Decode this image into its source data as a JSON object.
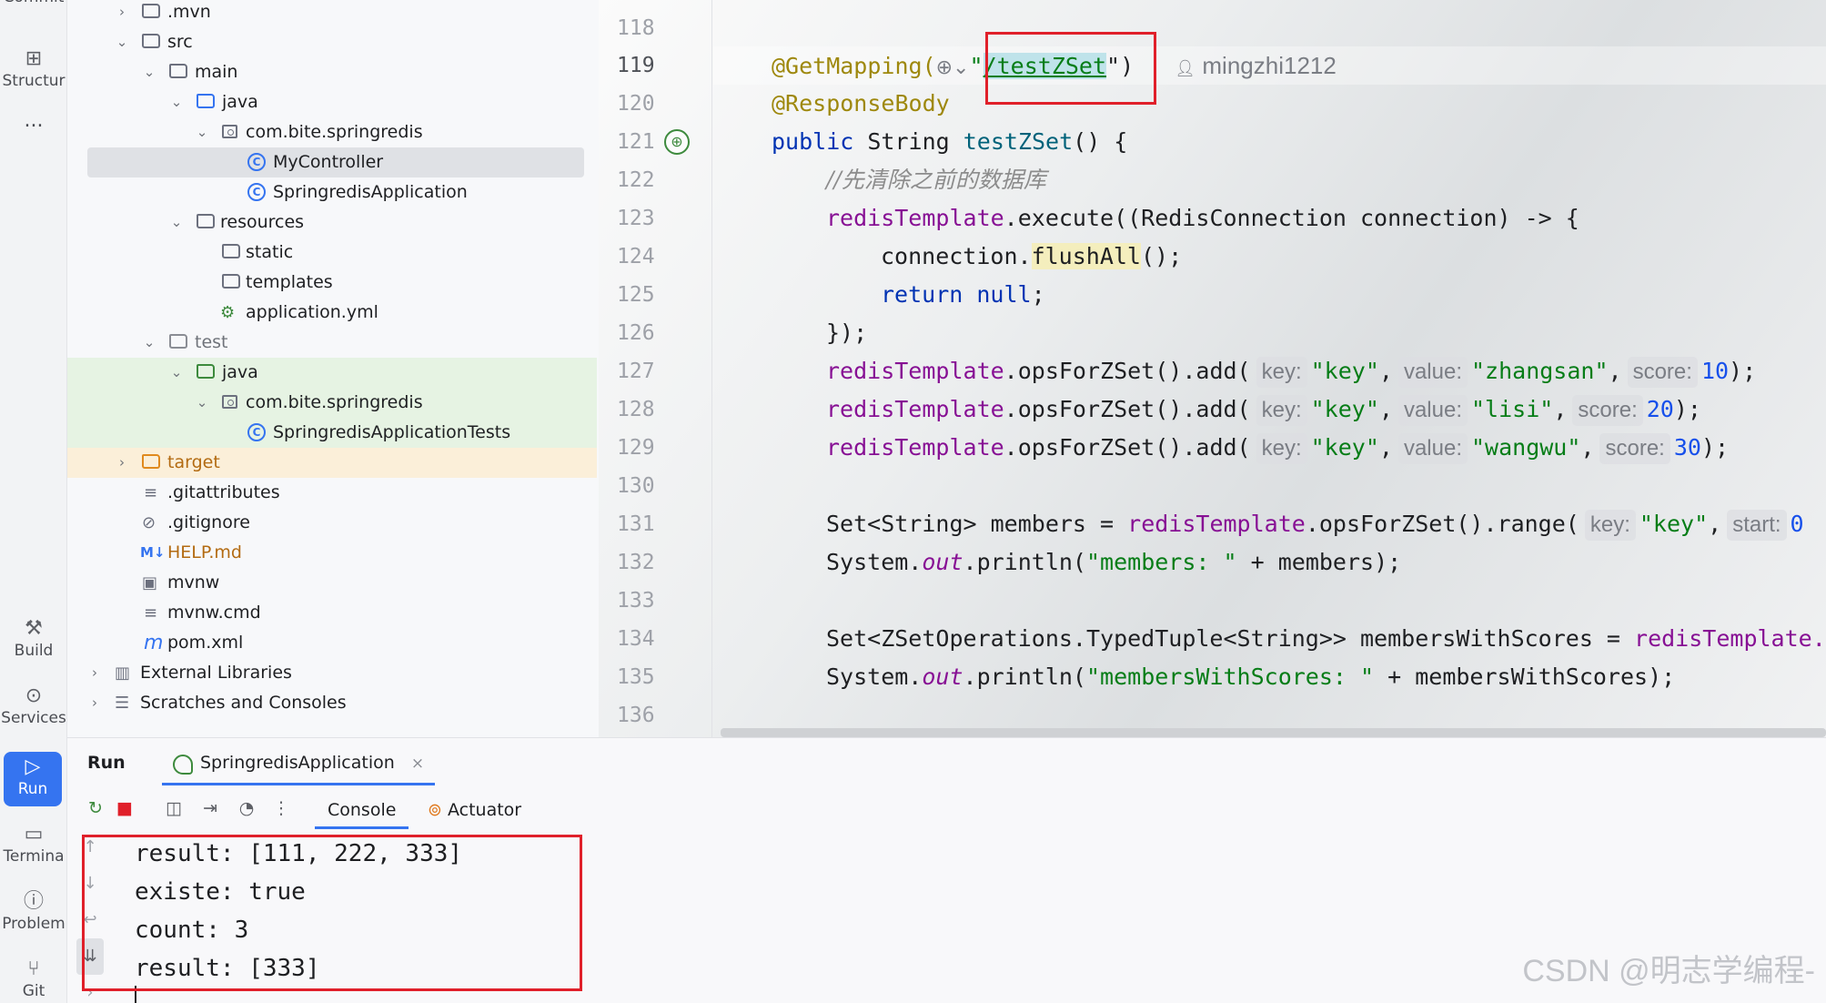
{
  "toolstrip": {
    "items": [
      {
        "label": "Commit",
        "icon": "commit-icon"
      },
      {
        "label": "Structur",
        "icon": "structure-icon"
      },
      {
        "label": "...",
        "icon": "more-icon"
      },
      {
        "label": "Build",
        "icon": "hammer-icon"
      },
      {
        "label": "Services",
        "icon": "services-icon"
      },
      {
        "label": "Run",
        "icon": "run-icon"
      },
      {
        "label": "Termina",
        "icon": "terminal-icon"
      },
      {
        "label": "Problem",
        "icon": "problems-icon"
      },
      {
        "label": "Git",
        "icon": "git-icon"
      }
    ]
  },
  "tree": {
    "items": [
      {
        "label": ".mvn"
      },
      {
        "label": "src"
      },
      {
        "label": "main"
      },
      {
        "label": "java"
      },
      {
        "label": "com.bite.springredis"
      },
      {
        "label": "MyController"
      },
      {
        "label": "SpringredisApplication"
      },
      {
        "label": "resources"
      },
      {
        "label": "static"
      },
      {
        "label": "templates"
      },
      {
        "label": "application.yml"
      },
      {
        "label": "test"
      },
      {
        "label": "java"
      },
      {
        "label": "com.bite.springredis"
      },
      {
        "label": "SpringredisApplicationTests"
      },
      {
        "label": "target"
      },
      {
        "label": ".gitattributes"
      },
      {
        "label": ".gitignore"
      },
      {
        "label": "HELP.md"
      },
      {
        "label": "mvnw"
      },
      {
        "label": "mvnw.cmd"
      },
      {
        "label": "pom.xml"
      },
      {
        "label": "External Libraries"
      },
      {
        "label": "Scratches and Consoles"
      }
    ],
    "md_badge": "M↓",
    "pom_glyph": "m"
  },
  "editor": {
    "line_numbers": [
      "118",
      "119",
      "120",
      "121",
      "122",
      "123",
      "124",
      "125",
      "126",
      "127",
      "128",
      "129",
      "130",
      "131",
      "132",
      "133",
      "134",
      "135",
      "136"
    ],
    "author": "mingzhi1212",
    "code": {
      "l119": {
        "ann": "@GetMapping(",
        "q1": "\"",
        "path": "/testZSet",
        "q2": "\")"
      },
      "l120": "@ResponseBody",
      "l121": {
        "kw": "public",
        "type": " String ",
        "fn": "testZSet",
        "rest": "() {"
      },
      "l122": "//先清除之前的数据库",
      "l123": {
        "fld": "redisTemplate",
        "rest": ".execute((RedisConnection connection) -> {"
      },
      "l124": {
        "pre": "connection.",
        "m": "flushAll",
        "rest": "();"
      },
      "l125": {
        "kw": "return",
        "kw2": " null",
        "rest": ";"
      },
      "l126": "});",
      "l127": {
        "fld": "redisTemplate",
        "mid": ".opsForZSet().add(",
        "h1": "key:",
        "s1": "\"key\"",
        "c1": ",",
        "h2": "value:",
        "s2": "\"zhangsan\"",
        "c2": ",",
        "h3": "score:",
        "n": "10",
        "end": ");"
      },
      "l128": {
        "fld": "redisTemplate",
        "mid": ".opsForZSet().add(",
        "h1": "key:",
        "s1": "\"key\"",
        "c1": ",",
        "h2": "value:",
        "s2": "\"lisi\"",
        "c2": ",",
        "h3": "score:",
        "n": "20",
        "end": ");"
      },
      "l129": {
        "fld": "redisTemplate",
        "mid": ".opsForZSet().add(",
        "h1": "key:",
        "s1": "\"key\"",
        "c1": ",",
        "h2": "value:",
        "s2": "\"wangwu\"",
        "c2": ",",
        "h3": "score:",
        "n": "30",
        "end": ");"
      },
      "l131": {
        "pre": "Set<String> members = ",
        "fld": "redisTemplate",
        "mid": ".opsForZSet().range(",
        "h1": "key:",
        "s1": "\"key\"",
        "c1": ",",
        "h2": "start:",
        "n": "0"
      },
      "l132": {
        "pre": "System.",
        "out": "out",
        "mid": ".println(",
        "s": "\"members: \"",
        "rest": " + members);"
      },
      "l134": {
        "pre": "Set<ZSetOperations.TypedTuple<String>> membersWithScores = ",
        "fld": "redisTemplate.o"
      },
      "l135": {
        "pre": "System.",
        "out": "out",
        "mid": ".println(",
        "s": "\"membersWithScores: \"",
        "rest": " + membersWithScores);"
      }
    }
  },
  "run": {
    "title": "Run",
    "tab": "SpringredisApplication",
    "close": "×",
    "console_tab": "Console",
    "actuator_tab": "Actuator",
    "output": [
      "result: [111, 222, 333]",
      "existe: true",
      "count: 3",
      "result: [333]"
    ]
  },
  "watermark": "CSDN @明志学编程-",
  "colors": {
    "accent": "#3574f0",
    "highlight_box": "#e0202a",
    "string": "#067d17",
    "keyword": "#0033b3",
    "field": "#871094"
  }
}
